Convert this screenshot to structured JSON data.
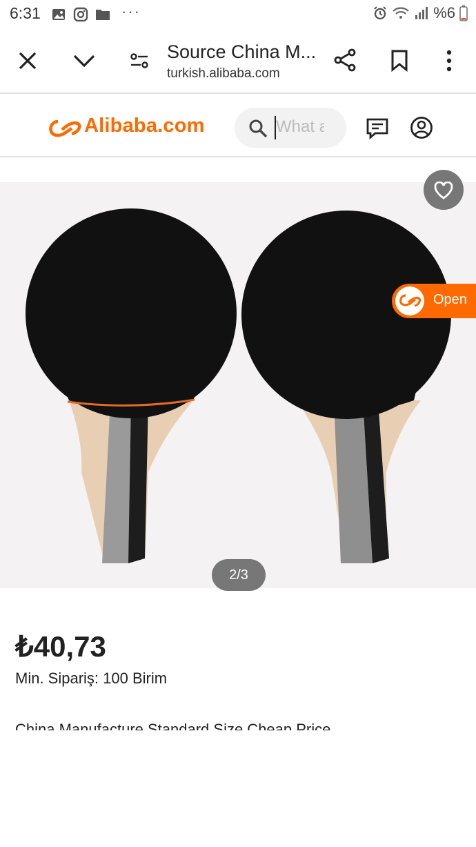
{
  "status_bar": {
    "time": "6:31",
    "battery": "%6"
  },
  "browser": {
    "title": "Source China M...",
    "url": "turkish.alibaba.com"
  },
  "site": {
    "logo": "Alibaba.com",
    "search_placeholder": "What a",
    "brand_color": "#ff6a00"
  },
  "gallery": {
    "counter": "2/3",
    "open_button": "Open"
  },
  "product": {
    "price": "₺40,73",
    "min_order": "Min. Sipariş: 100 Birim",
    "title_partial": "China Manufacture Standard Size Cheap Price"
  }
}
